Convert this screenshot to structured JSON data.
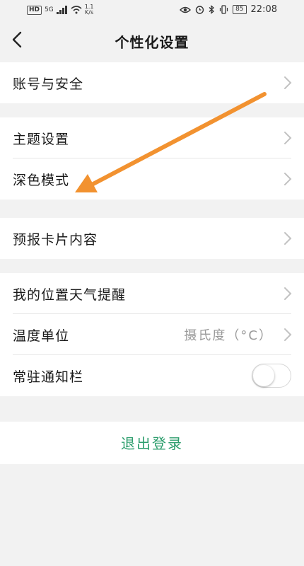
{
  "status_bar": {
    "network_hd": "HD",
    "network_type": "5G",
    "speed_value": "1.1",
    "speed_unit": "K/s",
    "battery": "85",
    "time": "22:08"
  },
  "header": {
    "title": "个性化设置"
  },
  "groups": [
    {
      "items": [
        {
          "label": "账号与安全"
        }
      ]
    },
    {
      "items": [
        {
          "label": "主题设置"
        },
        {
          "label": "深色模式"
        }
      ]
    },
    {
      "items": [
        {
          "label": "预报卡片内容"
        }
      ]
    },
    {
      "items": [
        {
          "label": "我的位置天气提醒"
        },
        {
          "label": "温度单位",
          "value": "摄氏度（°C）"
        },
        {
          "label": "常驻通知栏",
          "toggle": false
        }
      ]
    }
  ],
  "logout_label": "退出登录",
  "colors": {
    "accent": "#2e9e6e",
    "annotation_arrow": "#f29230"
  }
}
